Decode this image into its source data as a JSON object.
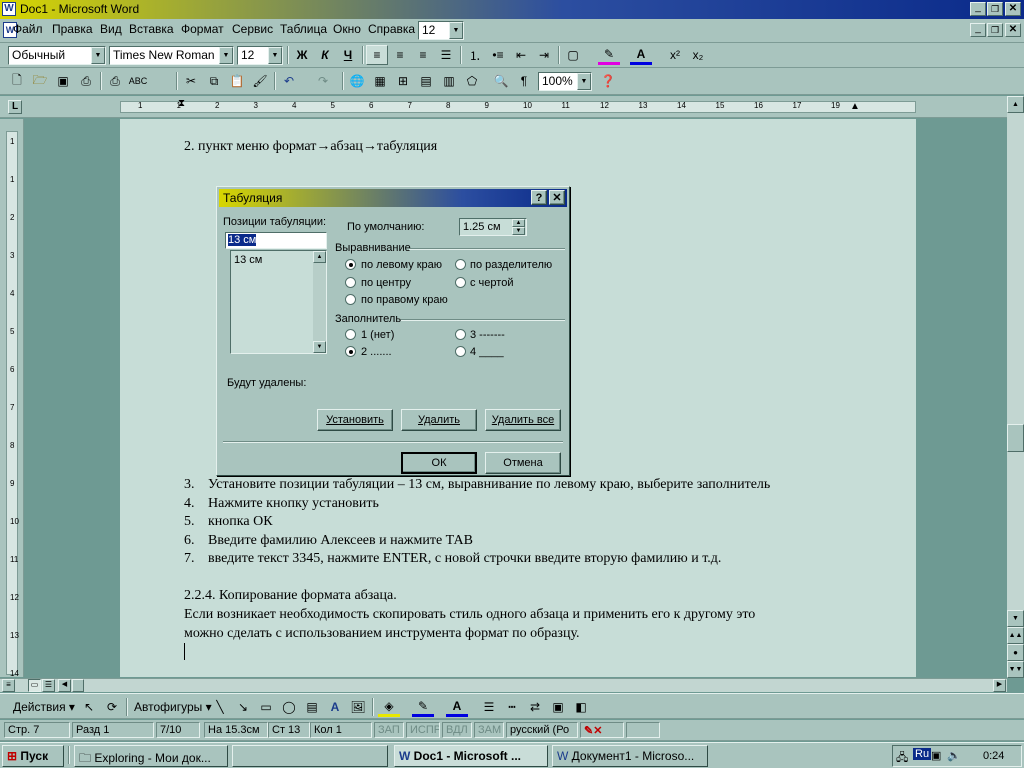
{
  "window": {
    "title": "Doc1 - Microsoft Word"
  },
  "menu": {
    "items": [
      "Файл",
      "Правка",
      "Вид",
      "Вставка",
      "Формат",
      "Сервис",
      "Таблица",
      "Окно",
      "Справка"
    ],
    "zoom_combo": "12"
  },
  "format_toolbar": {
    "style": "Обычный",
    "font": "Times New Roman",
    "size": "12",
    "bold": "Ж",
    "italic": "К",
    "underline": "Ч",
    "superscript": "x²",
    "subscript": "x₂"
  },
  "standard_toolbar": {
    "zoom": "100%",
    "pilcrow": "¶"
  },
  "ruler": {
    "h_ticks": [
      "1",
      "1",
      "2",
      "3",
      "4",
      "5",
      "6",
      "7",
      "8",
      "9",
      "10",
      "11",
      "12",
      "13",
      "14",
      "15",
      "16",
      "17",
      "19"
    ],
    "v_ticks": [
      "1",
      "1",
      "2",
      "3",
      "4",
      "5",
      "6",
      "7",
      "8",
      "9",
      "10",
      "11",
      "12",
      "13",
      "14"
    ]
  },
  "document": {
    "line1": "2.   пункт меню формат→абзац→табуляция",
    "items": [
      {
        "num": "3.",
        "text": "Установите позиции табуляции – 13 см, выравнивание по левому краю, выберите заполнитель"
      },
      {
        "num": "4.",
        "text": "Нажмите кнопку установить"
      },
      {
        "num": "5.",
        "text": "кнопка ОК"
      },
      {
        "num": "6.",
        "text": "Введите фамилию Алексеев и нажмите ТАВ"
      },
      {
        "num": "7.",
        "text": "введите текст 3345, нажмите ENTER, с новой строчки введите вторую фамилию и т.д."
      }
    ],
    "section_heading": "2.2.4. Копирование формата абзаца.",
    "para1": "Если возникает необходимость скопировать стиль одного абзаца и применить его к другому это",
    "para2": "можно сделать с использованием инструмента формат по образцу."
  },
  "dialog": {
    "title": "Табуляция",
    "help": "?",
    "close": "✕",
    "positions_label": "Позиции табуляции:",
    "position_value": "13 см",
    "list_items": [
      "13 см"
    ],
    "default_label": "По умолчанию:",
    "default_value": "1.25 см",
    "align_label": "Выравнивание",
    "align_options": [
      "по левому краю",
      "по центру",
      "по правому краю",
      "по разделителю",
      "с чертой"
    ],
    "fill_label": "Заполнитель",
    "fill_options": [
      "1 (нет)",
      "2 .......",
      "3 -------",
      "4 ____"
    ],
    "removed_label": "Будут удалены:",
    "btn_set": "Установить",
    "btn_remove": "Удалить",
    "btn_remove_all": "Удалить все",
    "btn_ok": "ОК",
    "btn_cancel": "Отмена"
  },
  "drawing_toolbar": {
    "actions": "Действия",
    "autoshapes": "Автофигуры"
  },
  "status": {
    "page": "Стр. 7",
    "section": "Разд 1",
    "pages": "7/10",
    "at": "На 15.3см",
    "line": "Ст 13",
    "col": "Кол 1",
    "rec": "ЗАП",
    "trk": "ИСПР",
    "ext": "ВДЛ",
    "ovr": "ЗАМ",
    "lang": "русский (Ро"
  },
  "taskbar": {
    "start": "Пуск",
    "tasks": [
      "Exploring - Мои док...",
      "",
      "Doc1 - Microsoft ...",
      "Документ1 - Microso..."
    ],
    "lang": "Ru",
    "clock": "0:24"
  },
  "colors": {
    "title_bar_start": "#d8d600",
    "title_bar_end": "#0a2a8a",
    "face": "#a9c4be",
    "page": "#c7ddd7"
  }
}
